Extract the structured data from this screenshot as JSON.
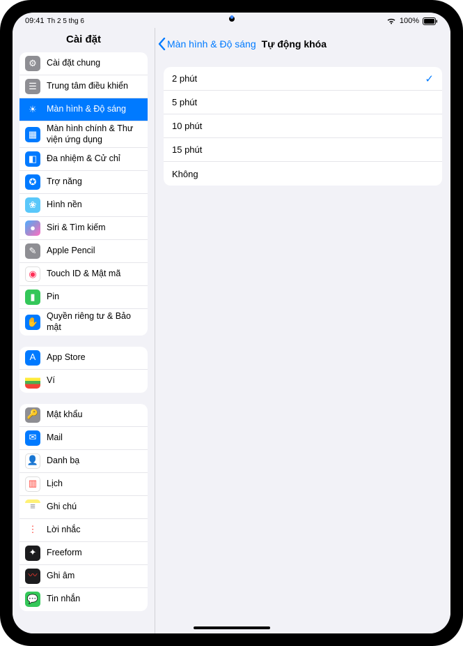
{
  "status": {
    "time": "09:41",
    "date": "Th 2 5 thg 6",
    "battery": "100%"
  },
  "sidebar": {
    "title": "Cài đặt",
    "groups": [
      {
        "items": [
          {
            "label": "Cài đặt chung",
            "icon": "gear-icon",
            "bg": "bg-gray",
            "glyph": "⚙"
          },
          {
            "label": "Trung tâm điều khiển",
            "icon": "switches-icon",
            "bg": "bg-gray",
            "glyph": "☰"
          },
          {
            "label": "Màn hình & Độ sáng",
            "icon": "brightness-icon",
            "bg": "bg-blue",
            "glyph": "☀",
            "selected": true
          },
          {
            "label": "Màn hình chính & Thư viện ứng dụng",
            "icon": "home-icon",
            "bg": "bg-blue",
            "glyph": "▦"
          },
          {
            "label": "Đa nhiệm & Cử chỉ",
            "icon": "multitask-icon",
            "bg": "bg-blue",
            "glyph": "◧"
          },
          {
            "label": "Trợ năng",
            "icon": "accessibility-icon",
            "bg": "bg-blue",
            "glyph": "✪"
          },
          {
            "label": "Hình nền",
            "icon": "wallpaper-icon",
            "bg": "bg-teal",
            "glyph": "❀"
          },
          {
            "label": "Siri & Tìm kiếm",
            "icon": "siri-icon",
            "bg": "bg-grad-siri",
            "glyph": "●"
          },
          {
            "label": "Apple Pencil",
            "icon": "pencil-icon",
            "bg": "bg-gray",
            "glyph": "✎"
          },
          {
            "label": "Touch ID & Mật mã",
            "icon": "touchid-icon",
            "bg": "bg-white",
            "glyph": "◉",
            "glyphColor": "#ff2d55"
          },
          {
            "label": "Pin",
            "icon": "battery-icon",
            "bg": "bg-green",
            "glyph": "▮"
          },
          {
            "label": "Quyền riêng tư & Bảo mật",
            "icon": "privacy-icon",
            "bg": "bg-blue",
            "glyph": "✋"
          }
        ]
      },
      {
        "items": [
          {
            "label": "App Store",
            "icon": "appstore-icon",
            "bg": "bg-blue",
            "glyph": "A"
          },
          {
            "label": "Ví",
            "icon": "wallet-icon",
            "bg": "bg-grad-wallet",
            "glyph": ""
          }
        ]
      },
      {
        "items": [
          {
            "label": "Mật khẩu",
            "icon": "passwords-icon",
            "bg": "bg-gray",
            "glyph": "🔑"
          },
          {
            "label": "Mail",
            "icon": "mail-icon",
            "bg": "bg-blue",
            "glyph": "✉"
          },
          {
            "label": "Danh bạ",
            "icon": "contacts-icon",
            "bg": "bg-white",
            "glyph": "👤",
            "glyphColor": "#8e8e93"
          },
          {
            "label": "Lịch",
            "icon": "calendar-icon",
            "bg": "bg-white",
            "glyph": "▥",
            "glyphColor": "#ff3b30"
          },
          {
            "label": "Ghi chú",
            "icon": "notes-icon",
            "bg": "bg-grad-notes",
            "glyph": "≡",
            "glyphColor": "#8e8e93"
          },
          {
            "label": "Lời nhắc",
            "icon": "reminders-icon",
            "bg": "bg-grad-rem",
            "glyph": "⋮",
            "glyphColor": "#ff3b30"
          },
          {
            "label": "Freeform",
            "icon": "freeform-icon",
            "bg": "bg-grad-freeform",
            "glyph": "✦",
            "glyphColor": "#fff"
          },
          {
            "label": "Ghi âm",
            "icon": "voicememo-icon",
            "bg": "bg-grad-voice",
            "glyph": "〰",
            "glyphColor": "#ff3b30"
          },
          {
            "label": "Tin nhắn",
            "icon": "messages-icon",
            "bg": "bg-green",
            "glyph": "💬"
          }
        ]
      }
    ]
  },
  "detail": {
    "back_label": "Màn hình & Độ sáng",
    "title": "Tự động khóa",
    "options": [
      {
        "label": "2 phút",
        "selected": true
      },
      {
        "label": "5 phút",
        "selected": false
      },
      {
        "label": "10 phút",
        "selected": false
      },
      {
        "label": "15 phút",
        "selected": false
      },
      {
        "label": "Không",
        "selected": false
      }
    ]
  }
}
